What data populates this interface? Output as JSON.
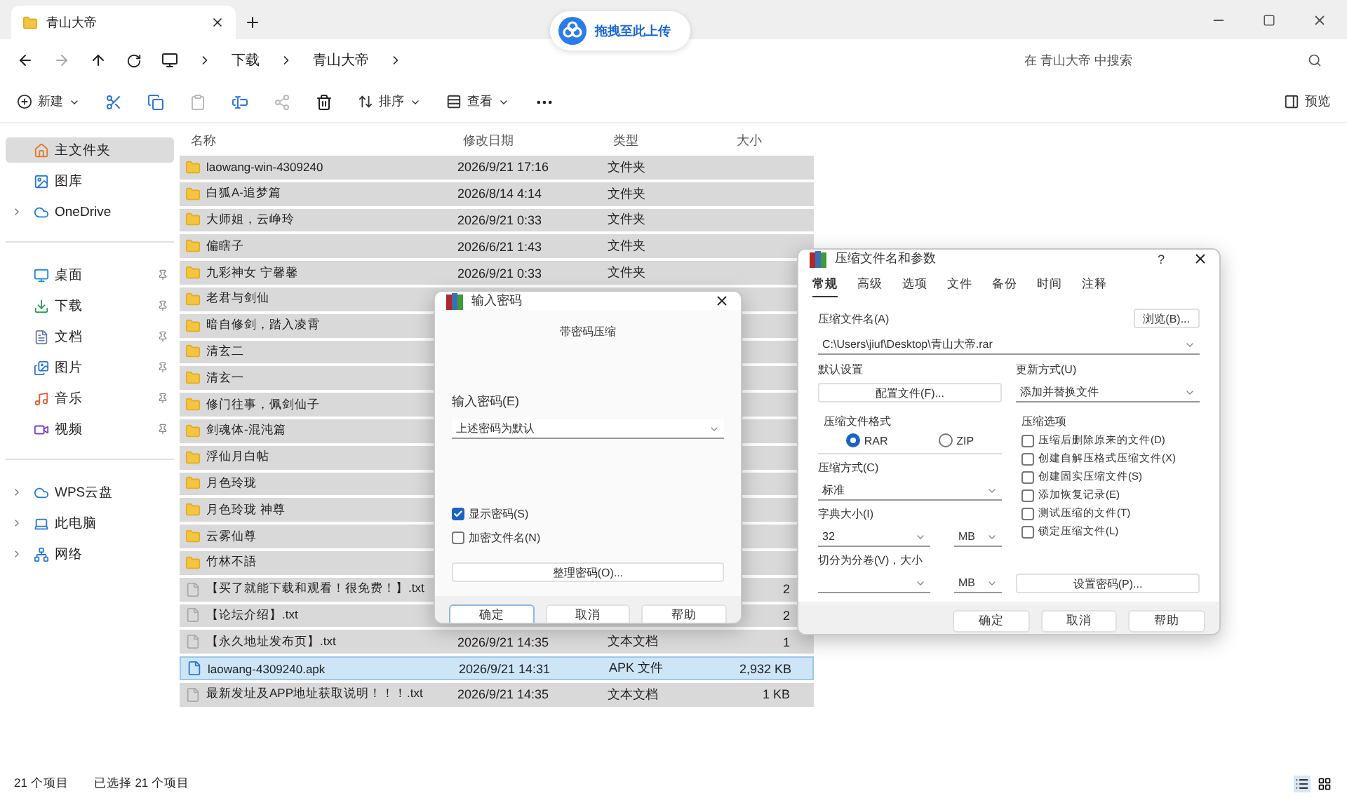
{
  "window": {
    "tab_title": "青山大帝"
  },
  "upload_badge": {
    "label": "拖拽至此上传"
  },
  "address": {
    "crumbs": [
      "下载",
      "青山大帝"
    ]
  },
  "search": {
    "placeholder": "在 青山大帝 中搜索"
  },
  "toolbar": {
    "new": "新建",
    "sort": "排序",
    "view": "查看",
    "preview": "预览"
  },
  "sidebar": {
    "groups": [
      [
        {
          "label": "主文件夹",
          "kind": "home",
          "selected": true,
          "expandable": false,
          "pinned": false
        },
        {
          "label": "图库",
          "kind": "gallery",
          "selected": false,
          "expandable": false,
          "pinned": false
        },
        {
          "label": "OneDrive",
          "kind": "cloud",
          "selected": false,
          "expandable": true,
          "pinned": false
        }
      ],
      [
        {
          "label": "桌面",
          "kind": "desktop",
          "selected": false,
          "expandable": false,
          "pinned": true
        },
        {
          "label": "下载",
          "kind": "download",
          "selected": false,
          "expandable": false,
          "pinned": true
        },
        {
          "label": "文档",
          "kind": "document",
          "selected": false,
          "expandable": false,
          "pinned": true
        },
        {
          "label": "图片",
          "kind": "picture",
          "selected": false,
          "expandable": false,
          "pinned": true
        },
        {
          "label": "音乐",
          "kind": "music",
          "selected": false,
          "expandable": false,
          "pinned": true
        },
        {
          "label": "视频",
          "kind": "video",
          "selected": false,
          "expandable": false,
          "pinned": true
        }
      ],
      [
        {
          "label": "WPS云盘",
          "kind": "cloud",
          "selected": false,
          "expandable": true,
          "pinned": false
        },
        {
          "label": "此电脑",
          "kind": "pc",
          "selected": false,
          "expandable": true,
          "pinned": false
        },
        {
          "label": "网络",
          "kind": "network",
          "selected": false,
          "expandable": true,
          "pinned": false
        }
      ]
    ]
  },
  "columns": [
    "名称",
    "修改日期",
    "类型",
    "大小"
  ],
  "rows": [
    {
      "kind": "folder",
      "name": "laowang-win-4309240",
      "date": "2026/9/21 17:16",
      "type": "文件夹",
      "selected": true,
      "focused": false
    },
    {
      "kind": "folder",
      "name": "白狐A-追梦篇",
      "date": "2026/8/14 4:14",
      "type": "文件夹",
      "selected": true,
      "focused": false
    },
    {
      "kind": "folder",
      "name": "大师姐，云峥玲",
      "date": "2026/9/21 0:33",
      "type": "文件夹",
      "selected": true,
      "focused": false
    },
    {
      "kind": "folder",
      "name": "偏瞎子",
      "date": "2026/6/21 1:43",
      "type": "文件夹",
      "selected": true,
      "focused": false
    },
    {
      "kind": "folder",
      "name": "九彩神女 宁馨馨",
      "date": "2026/9/21 0:33",
      "type": "文件夹",
      "selected": true,
      "focused": false
    },
    {
      "kind": "folder",
      "name": "老君与剑仙",
      "selected": true,
      "focused": false
    },
    {
      "kind": "folder",
      "name": "暗自修剑，踏入凌霄",
      "selected": true,
      "focused": false
    },
    {
      "kind": "folder",
      "name": "清玄二",
      "selected": true,
      "focused": false
    },
    {
      "kind": "folder",
      "name": "清玄一",
      "selected": true,
      "focused": false
    },
    {
      "kind": "folder",
      "name": "修门往事，佩剑仙子",
      "selected": true,
      "focused": false
    },
    {
      "kind": "folder",
      "name": "剑魂体-混沌篇",
      "selected": true,
      "focused": false
    },
    {
      "kind": "folder",
      "name": "浮仙月白帖",
      "selected": true,
      "focused": false
    },
    {
      "kind": "folder",
      "name": "月色玲珑",
      "selected": true,
      "focused": false
    },
    {
      "kind": "folder",
      "name": "月色玲珑 神尊",
      "selected": true,
      "focused": false
    },
    {
      "kind": "folder",
      "name": "云雾仙尊",
      "selected": true,
      "focused": false
    },
    {
      "kind": "folder",
      "name": "竹林不語",
      "selected": true,
      "focused": false
    },
    {
      "kind": "text",
      "name": "【买了就能下载和观看！很免费！】.txt",
      "size": "2",
      "selected": true,
      "focused": false
    },
    {
      "kind": "text",
      "name": "【论坛介绍】.txt",
      "size": "2",
      "selected": true,
      "focused": false
    },
    {
      "kind": "text",
      "name": "【永久地址发布页】.txt",
      "date": "2026/9/21 14:35",
      "type": "文本文档",
      "size": "1",
      "selected": true,
      "focused": false
    },
    {
      "kind": "apk",
      "name": "laowang-4309240.apk",
      "date": "2026/9/21 14:31",
      "type": "APK 文件",
      "size": "2,932 KB",
      "selected": true,
      "focused": true
    },
    {
      "kind": "text",
      "name": "最新发址及APP地址获取说明！！！.txt",
      "date": "2026/9/21 14:35",
      "type": "文本文档",
      "size": "1 KB",
      "selected": true,
      "focused": false
    }
  ],
  "status": {
    "count": "21 个项目",
    "selection": "已选择 21 个项目"
  },
  "password_dialog": {
    "title": "输入密码",
    "subtitle": "带密码压缩",
    "label": "输入密码(E)",
    "value": "上述密码为默认",
    "options": [
      {
        "label": "显示密码(S)",
        "checked": true
      },
      {
        "label": "加密文件名(N)",
        "checked": false
      }
    ],
    "organize": "整理密码(O)...",
    "buttons": [
      "确定",
      "取消",
      "帮助"
    ]
  },
  "archive_dialog": {
    "title": "压缩文件名和参数",
    "help": "?",
    "tabs": [
      {
        "label": "常规",
        "selected": true
      },
      {
        "label": "高级",
        "selected": false
      },
      {
        "label": "选项",
        "selected": false
      },
      {
        "label": "文件",
        "selected": false
      },
      {
        "label": "备份",
        "selected": false
      },
      {
        "label": "时间",
        "selected": false
      },
      {
        "label": "注释",
        "selected": false
      }
    ],
    "name_label": "压缩文件名(A)",
    "browse": "浏览(B)...",
    "path": "C:\\Users\\jiuf\\Desktop\\青山大帝.rar",
    "profile_label": "默认设置",
    "profile_button": "配置文件(F)...",
    "update_label": "更新方式(U)",
    "update_value": "添加并替换文件",
    "format_label": "压缩文件格式",
    "formats": [
      {
        "label": "RAR",
        "selected": true
      },
      {
        "label": "ZIP",
        "selected": false
      }
    ],
    "options_label": "压缩选项",
    "options": [
      {
        "label": "压缩后删除原来的文件(D)",
        "checked": false
      },
      {
        "label": "创建自解压格式压缩文件(X)",
        "checked": false
      },
      {
        "label": "创建固实压缩文件(S)",
        "checked": false
      },
      {
        "label": "添加恢复记录(E)",
        "checked": false
      },
      {
        "label": "测试压缩的文件(T)",
        "checked": false
      },
      {
        "label": "锁定压缩文件(L)",
        "checked": false
      }
    ],
    "method_label": "压缩方式(C)",
    "method_value": "标准",
    "dict_label": "字典大小(I)",
    "dict_value": "32",
    "dict_unit": "MB",
    "split_label": "切分为分卷(V)，大小",
    "split_unit": "MB",
    "password_button": "设置密码(P)...",
    "buttons": [
      "确定",
      "取消",
      "帮助"
    ]
  }
}
